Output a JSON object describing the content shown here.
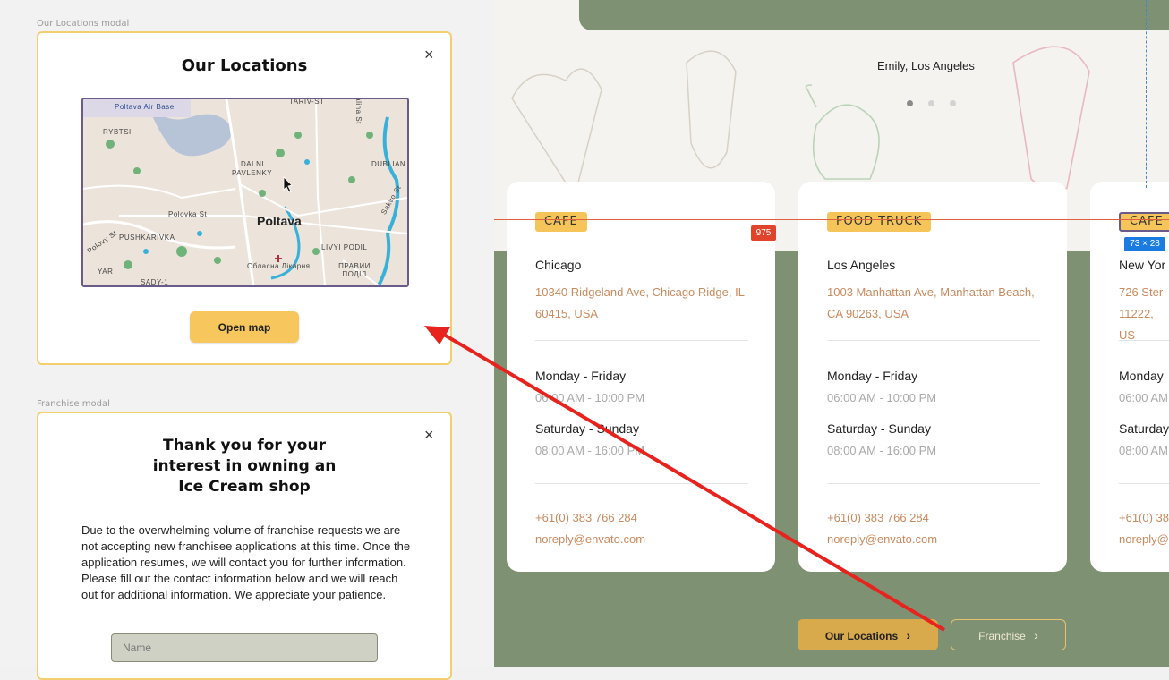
{
  "left": {
    "locations_frame_label": "Our Locations modal",
    "franchise_frame_label": "Franchise modal",
    "locations_modal": {
      "title": "Our Locations",
      "close": "×",
      "open_map_label": "Open map",
      "map": {
        "labels": {
          "air_base": "Poltava Air Base",
          "rybtsi": "RYBTSI",
          "dalni": "DALNI",
          "pavlenky": "PAVLENKY",
          "dublian": "DUBLIAN",
          "polovka_st": "Polovka St",
          "polovy_st": "Polovy St",
          "pushkarivka": "PUSHKARIVKA",
          "city": "Poltava",
          "livyi": "LIVYI PODIL",
          "yar": "YAR",
          "sady": "SADY-1",
          "hospital": "Обласна Лікарня",
          "pravyi": "ПРАВИИ ПОДІЛ",
          "sakvo": "Sakvo St",
          "tarutina": "TARIV-ST",
          "alina": "alina St"
        }
      }
    },
    "franchise_modal": {
      "close": "×",
      "title_line1": "Thank you for your",
      "title_line2": "interest in owning an",
      "title_line3": "Ice Cream shop",
      "body": "Due to the overwhelming volume of franchise requests we are not accepting new franchisee applications at this time. Once the application resumes, we will contact you for further information. Please fill out the contact information below and we will reach out for additional information. We appreciate your patience.",
      "name_placeholder": "Name"
    }
  },
  "right": {
    "testimonial_name": "Emily, Los Angeles",
    "carousel_dots": 3,
    "active_dot": 0,
    "badge_975": "975",
    "dim_badge": "73 × 28",
    "cards": [
      {
        "tag": "CAFE",
        "city": "Chicago",
        "address": "10340 Ridgeland Ave, Chicago Ridge, IL 60415, USA",
        "weekday_label": "Monday - Friday",
        "weekday_hours": "06:00 AM - 10:00 PM",
        "weekend_label": "Saturday - Sunday",
        "weekend_hours": "08:00 AM - 16:00 PM",
        "phone": "+61(0) 383 766 284",
        "email": "noreply@envato.com"
      },
      {
        "tag": "FOOD TRUCK",
        "city": "Los Angeles",
        "address": "1003 Manhattan Ave, Manhattan Beach, CA 90263, USA",
        "weekday_label": "Monday - Friday",
        "weekday_hours": "06:00 AM - 10:00 PM",
        "weekend_label": "Saturday - Sunday",
        "weekend_hours": "08:00 AM - 16:00 PM",
        "phone": "+61(0) 383 766 284",
        "email": "noreply@envato.com"
      },
      {
        "tag": "CAFE",
        "city": "New Yor",
        "address": "726 Ster 11222, US",
        "weekday_label": "Monday",
        "weekday_hours": "06:00 AM",
        "weekend_label": "Saturday",
        "weekend_hours": "08:00 AM",
        "phone": "+61(0) 38",
        "email": "noreply@"
      }
    ],
    "our_locations_button": "Our Locations",
    "franchise_button": "Franchise",
    "chevron": "›"
  },
  "colors": {
    "accent_yellow": "#f7c65c",
    "green": "#7e9273",
    "address_orange": "#c98a5e",
    "arrow_red": "#e8221d"
  }
}
